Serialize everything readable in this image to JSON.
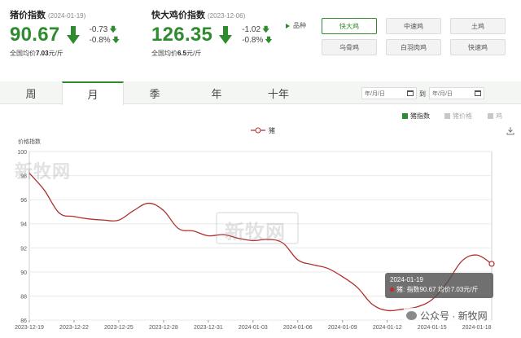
{
  "pig": {
    "title": "猪价指数",
    "date": "(2024-01-19)",
    "value": "90.67",
    "change_abs": "-0.73",
    "change_pct": "-0.8%",
    "sub_prefix": "全国均价",
    "sub_value": "7.03",
    "sub_unit": "元/斤"
  },
  "chicken": {
    "title": "快大鸡价指数",
    "date": "(2023-12-06)",
    "value": "126.35",
    "change_abs": "-1.02",
    "change_pct": "-0.8%",
    "sub_prefix": "全国均价",
    "sub_value": "6.5",
    "sub_unit": "元/斤"
  },
  "breeds": {
    "label": "品种",
    "items": [
      "快大鸡",
      "中速鸡",
      "土鸡",
      "乌骨鸡",
      "白羽肉鸡",
      "快速鸡"
    ],
    "selected": "快大鸡"
  },
  "tabs": [
    "周",
    "月",
    "季",
    "年",
    "十年"
  ],
  "active_tab": "月",
  "date_range": {
    "start_placeholder": "年/月/日",
    "end_placeholder": "年/月/日",
    "to_label": "到"
  },
  "series_selectors": [
    {
      "label": "猪指数",
      "active": true
    },
    {
      "label": "猪价格",
      "active": false
    },
    {
      "label": "鸡",
      "active": false
    }
  ],
  "colors": {
    "accent": "#2e8b2e",
    "line": "#b03030",
    "inactive": "#bbbbbb"
  },
  "chart_data": {
    "type": "line",
    "legend": "猪",
    "ylabel": "价格指数",
    "ylim": [
      86,
      100
    ],
    "yticks": [
      86,
      88,
      90,
      92,
      94,
      96,
      98,
      100
    ],
    "x_tick_labels": [
      "2023-12-19",
      "2023-12-22",
      "2023-12-25",
      "2023-12-28",
      "2023-12-31",
      "2024-01-03",
      "2024-01-06",
      "2024-01-09",
      "2024-01-12",
      "2024-01-15",
      "2024-01-18"
    ],
    "x": [
      "2023-12-19",
      "2023-12-20",
      "2023-12-21",
      "2023-12-22",
      "2023-12-23",
      "2023-12-24",
      "2023-12-25",
      "2023-12-26",
      "2023-12-27",
      "2023-12-28",
      "2023-12-29",
      "2023-12-30",
      "2023-12-31",
      "2024-01-01",
      "2024-01-02",
      "2024-01-03",
      "2024-01-04",
      "2024-01-05",
      "2024-01-06",
      "2024-01-07",
      "2024-01-08",
      "2024-01-09",
      "2024-01-10",
      "2024-01-11",
      "2024-01-12",
      "2024-01-13",
      "2024-01-14",
      "2024-01-15",
      "2024-01-16",
      "2024-01-17",
      "2024-01-18",
      "2024-01-19"
    ],
    "series": [
      {
        "name": "猪",
        "values": [
          98.2,
          96.8,
          94.9,
          94.6,
          94.4,
          94.3,
          94.3,
          95.1,
          95.7,
          95.1,
          93.6,
          93.4,
          93.0,
          93.1,
          92.8,
          92.6,
          92.7,
          92.4,
          91.0,
          90.6,
          90.3,
          89.6,
          88.7,
          87.3,
          86.8,
          86.9,
          87.1,
          87.7,
          89.1,
          90.9,
          91.4,
          90.67
        ]
      }
    ],
    "tooltip": {
      "date": "2024-01-19",
      "series": "猪:",
      "index_label": "指数",
      "index_value": "90.67",
      "price_label": "均价",
      "price_value": "7.03元/斤"
    }
  },
  "watermarks": {
    "brand": "新牧网",
    "footer": "公众号 · 新牧网"
  }
}
